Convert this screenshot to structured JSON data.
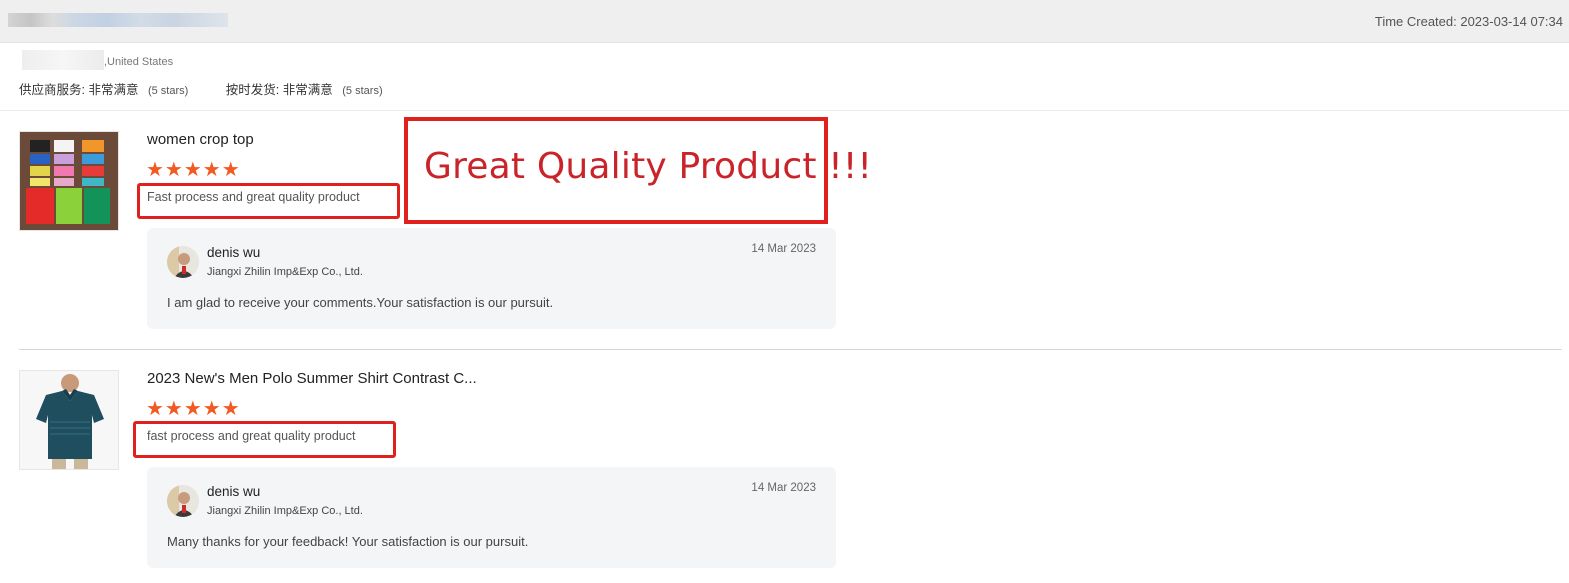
{
  "header": {
    "time_created": "Time Created: 2023-03-14 07:34"
  },
  "buyer": {
    "country": ",United States"
  },
  "ratings": [
    {
      "label": "供应商服务:",
      "value": "非常满意",
      "stars": "(5 stars)"
    },
    {
      "label": "按时发货:",
      "value": "非常满意",
      "stars": "(5 stars)"
    }
  ],
  "reviews": [
    {
      "title": "women crop top",
      "stars": "★★★★★",
      "rating": 5,
      "comment": "Fast process and great quality product",
      "reply": {
        "name": "denis wu",
        "company": "Jiangxi Zhilin Imp&Exp Co., Ltd.",
        "date": "14 Mar 2023",
        "message": "I am glad to receive your comments.Your satisfaction is our pursuit."
      }
    },
    {
      "title": "2023 New's Men Polo Summer Shirt Contrast C...",
      "stars": "★★★★★",
      "rating": 5,
      "comment": "fast process and great quality product",
      "reply": {
        "name": "denis wu",
        "company": "Jiangxi Zhilin Imp&Exp Co., Ltd.",
        "date": "14 Mar 2023",
        "message": "Many thanks for your feedback! Your satisfaction is our pursuit."
      }
    }
  ],
  "callout": {
    "text": "Great Quality Product !!!"
  },
  "colors": {
    "star": "#f15a22",
    "highlight": "#e0201c",
    "callout_text": "#c8242a"
  }
}
